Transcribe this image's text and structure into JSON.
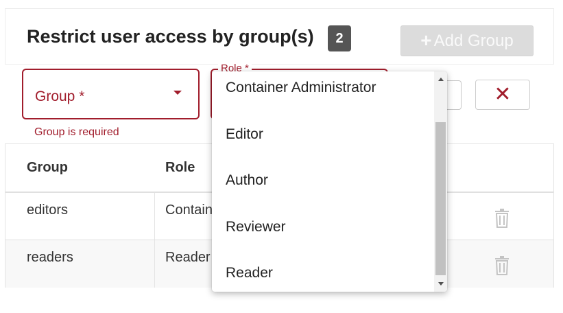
{
  "header": {
    "title": "Restrict user access by group(s)",
    "count": "2",
    "add_button_label": "Add Group",
    "add_button_icon": "plus-icon"
  },
  "form": {
    "group_placeholder": "Group *",
    "group_error": "Group is required",
    "role_label": "Role *",
    "clear_symbol": "✕"
  },
  "table": {
    "headers": [
      "Group",
      "Role"
    ],
    "rows": [
      {
        "group": "editors",
        "role": "Contain"
      },
      {
        "group": "readers",
        "role": "Reader"
      }
    ],
    "delete_icon": "trash-icon"
  },
  "role_dropdown": {
    "options": [
      "Container Administrator",
      "Editor",
      "Author",
      "Reviewer",
      "Reader"
    ]
  },
  "colors": {
    "error": "#a11d2c",
    "badge": "#555555",
    "disabled_button": "#dcdcdc"
  }
}
